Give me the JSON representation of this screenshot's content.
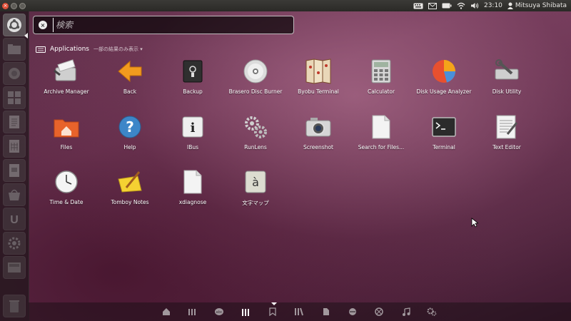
{
  "top_panel": {
    "keyboard_indicator": "keyboard-icon",
    "mail_indicator": "envelope-icon",
    "battery_indicator": "battery-icon",
    "network_indicator": "wifi-icon",
    "sound_indicator": "speaker-icon",
    "clock": "23:10",
    "user_name": "Mitsuya Shibata",
    "window_buttons": [
      "close",
      "minimize",
      "maximize"
    ]
  },
  "launcher": {
    "items": [
      "ubuntu-logo-icon",
      "folder-icon",
      "firefox-icon",
      "workspaces-icon",
      "writer-icon",
      "calc-icon",
      "impress-icon",
      "software-center-icon",
      "ubuntu-one-icon",
      "system-settings-icon",
      "workspace-switcher-icon",
      "trash-icon"
    ]
  },
  "search": {
    "placeholder": "検索",
    "value": ""
  },
  "section": {
    "title": "Applications",
    "note": "一部の結果のみ表示"
  },
  "apps": [
    {
      "label": "Archive Manager",
      "icon": "archive-manager-icon"
    },
    {
      "label": "Back",
      "icon": "back-arrow-icon"
    },
    {
      "label": "Backup",
      "icon": "backup-safe-icon"
    },
    {
      "label": "Brasero Disc Burner",
      "icon": "disc-icon"
    },
    {
      "label": "Byobu Terminal",
      "icon": "byobu-screen-icon"
    },
    {
      "label": "Calculator",
      "icon": "calculator-icon"
    },
    {
      "label": "Disk Usage Analyzer",
      "icon": "pie-chart-icon"
    },
    {
      "label": "Disk Utility",
      "icon": "disk-utility-icon"
    },
    {
      "label": "Files",
      "icon": "home-folder-icon"
    },
    {
      "label": "Help",
      "icon": "help-icon"
    },
    {
      "label": "IBus",
      "icon": "info-icon"
    },
    {
      "label": "RunLens",
      "icon": "gears-icon"
    },
    {
      "label": "Screenshot",
      "icon": "camera-icon"
    },
    {
      "label": "Search for Files...",
      "icon": "blank-document-icon"
    },
    {
      "label": "Terminal",
      "icon": "terminal-icon"
    },
    {
      "label": "Text Editor",
      "icon": "text-editor-icon"
    },
    {
      "label": "Time & Date",
      "icon": "clock-icon"
    },
    {
      "label": "Tomboy Notes",
      "icon": "notes-icon"
    },
    {
      "label": "xdiagnose",
      "icon": "blank-document-icon"
    },
    {
      "label": "文字マップ",
      "icon": "character-map-icon"
    }
  ],
  "lenses": [
    "home-lens-icon",
    "apps-lens-icon",
    "dictionary-lens-icon",
    "applications-lens-icon",
    "bookmark-lens-icon",
    "library-lens-icon",
    "files-lens-icon",
    "python-lens-icon",
    "network-lens-icon",
    "music-lens-icon",
    "settings-lens-icon"
  ],
  "active_lens": "applications-lens-icon"
}
